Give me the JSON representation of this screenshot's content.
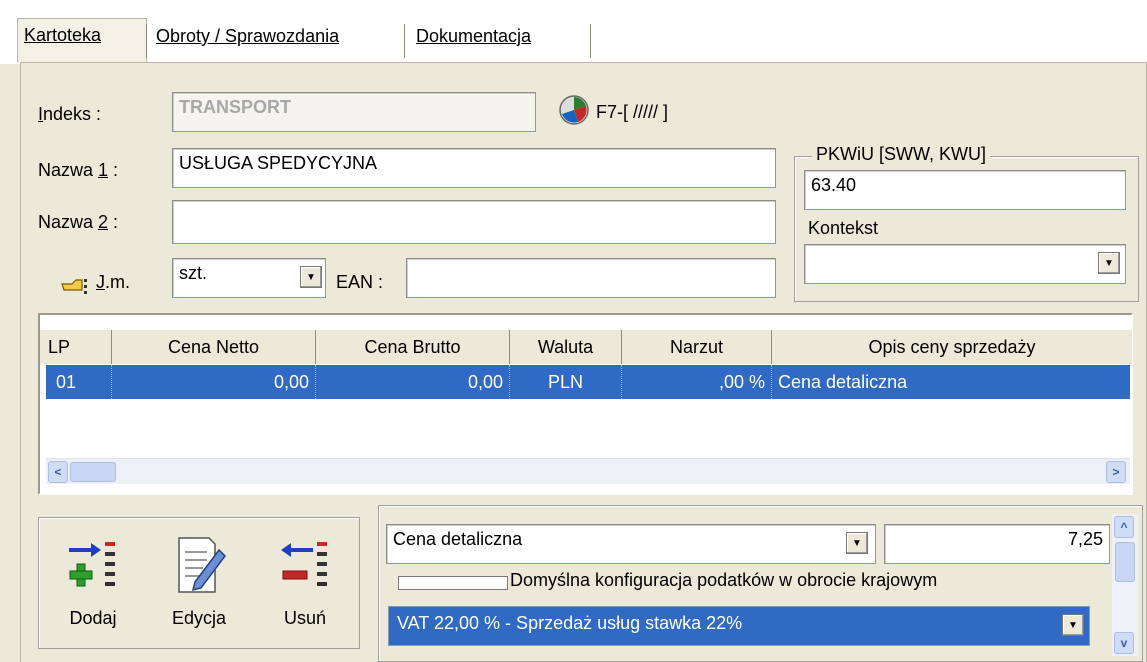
{
  "tabs": [
    "Kartoteka",
    "Obroty / Sprawozdania",
    "Dokumentacja"
  ],
  "form": {
    "indeks_label": "ndeks  :",
    "indeks_underlined": "I",
    "indeks_value": "TRANSPORT",
    "f7_label": "F7-[ ///// ]",
    "nazwa1_label_pre": "Nazwa ",
    "nazwa1_label_key": "1",
    "nazwa1_label_post": " :",
    "nazwa1_value": "USŁUGA SPEDYCYJNA",
    "nazwa2_label_pre": "Nazwa ",
    "nazwa2_label_key": "2",
    "nazwa2_label_post": " :",
    "nazwa2_value": "",
    "jm_label_key": "J",
    "jm_label_post": ".m.",
    "jm_value": "szt.",
    "ean_label": "EAN :",
    "ean_value": ""
  },
  "pkwiu": {
    "title": "PKWiU [SWW, KWU]",
    "value": "63.40",
    "kontekst_label": "Kontekst",
    "kontekst_value": ""
  },
  "grid": {
    "columns": [
      "LP",
      "Cena Netto",
      "Cena Brutto",
      "Waluta",
      "Narzut",
      "Opis ceny sprzedaży"
    ],
    "rows": [
      {
        "lp": "01",
        "netto": "0,00",
        "brutto": "0,00",
        "waluta": "PLN",
        "narzut": ",00 %",
        "opis": "Cena detaliczna"
      }
    ]
  },
  "buttons": {
    "dodaj": "Dodaj",
    "edycja": "Edycja",
    "usun": "Usuń"
  },
  "price": {
    "type_value": "Cena detaliczna",
    "amount": "7,25",
    "domestic_checkbox_label": "Domyślna konfiguracja podatków w obrocie krajowym",
    "vat_value": "VAT 22,00 % - Sprzedaż usług stawka 22%"
  },
  "colors": {
    "selection": "#316ac5",
    "background": "#ece9d8"
  }
}
